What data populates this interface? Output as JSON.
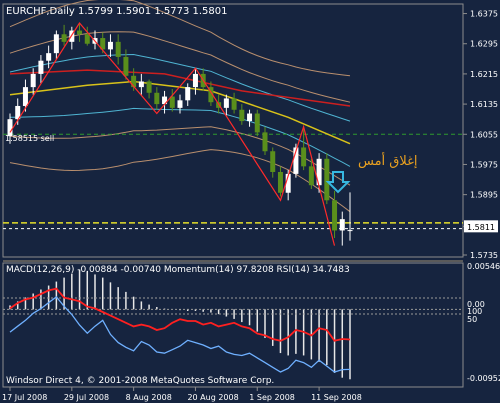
{
  "window": {
    "header": "EURCHF,Daily  1.5799 1.5901 1.5773 1.5801"
  },
  "annotations": {
    "arabic": "إغلاق أمس",
    "line_label": "1.58515 sell",
    "current_price": "1.5811",
    "sub_header": "MACD(12,26,9) -0.00884 -0.00740  Momentum(14) 97.8208  RSI(14) 34.7483",
    "footer": "Windsor Direct 4, © 2001-2008 MetaQuotes Software Corp."
  },
  "colors": {
    "background": "#16243f",
    "candle_up": "#ffffff",
    "candle_down": "#5a8f1c",
    "bollinger": "#b98f6e",
    "envelope": "#4fb4d2",
    "ma_red": "#cc1f1f",
    "ma_yellow": "#d8c21a",
    "zigzag": "#ff2a2a",
    "dashed_yellow": "#e6e02a",
    "dashed_green": "#2e9a2e",
    "arabic_text": "#e8a020",
    "arrow": "#37b7e0",
    "macd_hist": "#e8e8e8",
    "momentum": "#6fb0ff",
    "rsi": "#ff2020",
    "level_lines": "#9a9a9a"
  },
  "chart_data": [
    {
      "type": "candlestick",
      "ylim": [
        1.5735,
        1.6395
      ],
      "y_ticks": [
        "1.6375",
        "1.6295",
        "1.6215",
        "1.6135",
        "1.6055",
        "1.5975",
        "1.5895",
        "1.5811",
        "1.5735"
      ],
      "x_ticks": [
        "17 Jul 2008",
        "29 Jul 2008",
        "8 Aug 2008",
        "20 Aug 2008",
        "1 Sep 2008",
        "11 Sep 2008"
      ],
      "candles": [
        {
          "o": 1.605,
          "h": 1.611,
          "l": 1.603,
          "c": 1.6095
        },
        {
          "o": 1.6095,
          "h": 1.615,
          "l": 1.608,
          "c": 1.613
        },
        {
          "o": 1.613,
          "h": 1.62,
          "l": 1.6115,
          "c": 1.618
        },
        {
          "o": 1.618,
          "h": 1.623,
          "l": 1.616,
          "c": 1.6215
        },
        {
          "o": 1.6215,
          "h": 1.6265,
          "l": 1.619,
          "c": 1.625
        },
        {
          "o": 1.625,
          "h": 1.629,
          "l": 1.623,
          "c": 1.627
        },
        {
          "o": 1.627,
          "h": 1.633,
          "l": 1.6255,
          "c": 1.632
        },
        {
          "o": 1.632,
          "h": 1.6345,
          "l": 1.629,
          "c": 1.63
        },
        {
          "o": 1.63,
          "h": 1.634,
          "l": 1.628,
          "c": 1.633
        },
        {
          "o": 1.633,
          "h": 1.635,
          "l": 1.63,
          "c": 1.632
        },
        {
          "o": 1.632,
          "h": 1.634,
          "l": 1.629,
          "c": 1.6295
        },
        {
          "o": 1.6295,
          "h": 1.633,
          "l": 1.628,
          "c": 1.631
        },
        {
          "o": 1.631,
          "h": 1.6325,
          "l": 1.627,
          "c": 1.628
        },
        {
          "o": 1.628,
          "h": 1.632,
          "l": 1.626,
          "c": 1.63
        },
        {
          "o": 1.63,
          "h": 1.632,
          "l": 1.624,
          "c": 1.626
        },
        {
          "o": 1.626,
          "h": 1.628,
          "l": 1.62,
          "c": 1.621
        },
        {
          "o": 1.621,
          "h": 1.623,
          "l": 1.617,
          "c": 1.618
        },
        {
          "o": 1.618,
          "h": 1.6215,
          "l": 1.616,
          "c": 1.6195
        },
        {
          "o": 1.6195,
          "h": 1.62,
          "l": 1.615,
          "c": 1.6165
        },
        {
          "o": 1.6165,
          "h": 1.618,
          "l": 1.612,
          "c": 1.6135
        },
        {
          "o": 1.6135,
          "h": 1.617,
          "l": 1.611,
          "c": 1.6155
        },
        {
          "o": 1.6155,
          "h": 1.6175,
          "l": 1.6115,
          "c": 1.6125
        },
        {
          "o": 1.6125,
          "h": 1.616,
          "l": 1.611,
          "c": 1.6145
        },
        {
          "o": 1.6145,
          "h": 1.619,
          "l": 1.613,
          "c": 1.618
        },
        {
          "o": 1.618,
          "h": 1.623,
          "l": 1.616,
          "c": 1.6215
        },
        {
          "o": 1.6215,
          "h": 1.623,
          "l": 1.617,
          "c": 1.618
        },
        {
          "o": 1.618,
          "h": 1.6195,
          "l": 1.613,
          "c": 1.614
        },
        {
          "o": 1.614,
          "h": 1.616,
          "l": 1.611,
          "c": 1.6125
        },
        {
          "o": 1.6125,
          "h": 1.616,
          "l": 1.6105,
          "c": 1.615
        },
        {
          "o": 1.615,
          "h": 1.6165,
          "l": 1.611,
          "c": 1.612
        },
        {
          "o": 1.612,
          "h": 1.6135,
          "l": 1.608,
          "c": 1.609
        },
        {
          "o": 1.609,
          "h": 1.612,
          "l": 1.6075,
          "c": 1.611
        },
        {
          "o": 1.611,
          "h": 1.612,
          "l": 1.605,
          "c": 1.606
        },
        {
          "o": 1.606,
          "h": 1.6075,
          "l": 1.6,
          "c": 1.601
        },
        {
          "o": 1.601,
          "h": 1.602,
          "l": 1.594,
          "c": 1.5955
        },
        {
          "o": 1.5955,
          "h": 1.597,
          "l": 1.589,
          "c": 1.59
        },
        {
          "o": 1.59,
          "h": 1.596,
          "l": 1.588,
          "c": 1.595
        },
        {
          "o": 1.595,
          "h": 1.603,
          "l": 1.594,
          "c": 1.602
        },
        {
          "o": 1.602,
          "h": 1.6075,
          "l": 1.596,
          "c": 1.597
        },
        {
          "o": 1.597,
          "h": 1.599,
          "l": 1.591,
          "c": 1.592
        },
        {
          "o": 1.592,
          "h": 1.6005,
          "l": 1.59,
          "c": 1.599
        },
        {
          "o": 1.599,
          "h": 1.6005,
          "l": 1.587,
          "c": 1.588
        },
        {
          "o": 1.588,
          "h": 1.5905,
          "l": 1.578,
          "c": 1.58
        },
        {
          "o": 1.58,
          "h": 1.585,
          "l": 1.576,
          "c": 1.583
        },
        {
          "o": 1.5799,
          "h": 1.5901,
          "l": 1.5773,
          "c": 1.5801
        }
      ],
      "ma_red": [
        [
          0,
          1.6215
        ],
        [
          10,
          1.6225
        ],
        [
          20,
          1.6215
        ],
        [
          30,
          1.617
        ],
        [
          44,
          1.613
        ]
      ],
      "ma_yellow": [
        [
          0,
          1.616
        ],
        [
          10,
          1.6185
        ],
        [
          16,
          1.6195
        ],
        [
          26,
          1.617
        ],
        [
          36,
          1.61
        ],
        [
          44,
          1.603
        ]
      ],
      "zigzag": [
        [
          0,
          1.606
        ],
        [
          9,
          1.635
        ],
        [
          19,
          1.611
        ],
        [
          24,
          1.623
        ],
        [
          35,
          1.588
        ],
        [
          38,
          1.6075
        ],
        [
          42,
          1.576
        ]
      ],
      "hlines": {
        "green_dashed": 1.6055,
        "yellow_dashed": 1.582,
        "white_dashed": 1.5805
      }
    },
    {
      "type": "line",
      "title": "MACD(12,26,9) -0.00884 -0.00740  Momentum(14) 97.8208  RSI(14) 34.7483",
      "y_ticks": [
        "0.00546",
        "0.00",
        "100",
        "50",
        "-0.00952"
      ],
      "macd_hist": [
        0.0005,
        0.001,
        0.0015,
        0.002,
        0.0025,
        0.003,
        0.0035,
        0.004,
        0.0045,
        0.005,
        0.0048,
        0.0044,
        0.004,
        0.0034,
        0.0028,
        0.0022,
        0.0016,
        0.001,
        0.0006,
        0.0003,
        0.0001,
        0.0,
        -0.0001,
        -0.0002,
        -0.0002,
        -0.0003,
        -0.0004,
        -0.0006,
        -0.0009,
        -0.0012,
        -0.0016,
        -0.002,
        -0.0028,
        -0.0036,
        -0.0046,
        -0.0055,
        -0.0058,
        -0.0056,
        -0.0058,
        -0.0063,
        -0.0066,
        -0.007,
        -0.008,
        -0.0086,
        -0.0088
      ],
      "momentum": [
        101.0,
        101.5,
        102.0,
        102.6,
        103.0,
        103.5,
        104.0,
        103.2,
        102.5,
        101.6,
        100.9,
        101.5,
        102.0,
        100.8,
        100.1,
        99.7,
        99.4,
        100.2,
        99.9,
        99.3,
        99.2,
        99.5,
        99.8,
        100.3,
        100.1,
        99.9,
        99.6,
        99.8,
        99.3,
        99.1,
        99.0,
        99.2,
        98.8,
        98.4,
        98.0,
        97.6,
        97.9,
        98.6,
        98.4,
        98.0,
        98.6,
        98.1,
        97.6,
        97.8,
        97.82
      ],
      "rsi": [
        52,
        55,
        57,
        58,
        60,
        62,
        63,
        58,
        57,
        56,
        53,
        52,
        50,
        48,
        46,
        44,
        42,
        43,
        42,
        40,
        41,
        44,
        46,
        45,
        45,
        43,
        44,
        42,
        43,
        44,
        42,
        41,
        38,
        37,
        35,
        34,
        36,
        40,
        39,
        37,
        41,
        40,
        34,
        35,
        34.7
      ]
    }
  ]
}
